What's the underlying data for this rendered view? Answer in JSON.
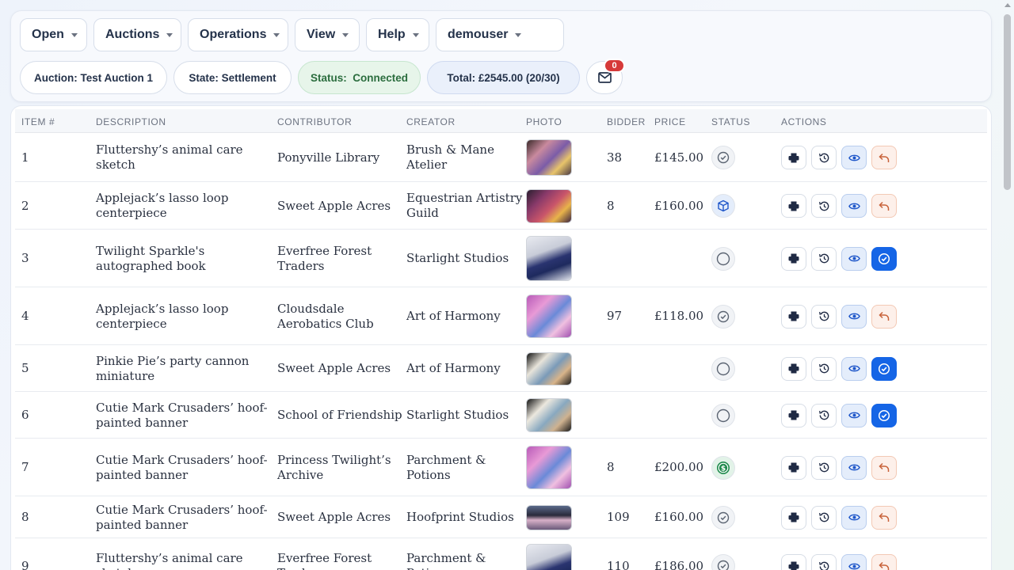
{
  "menu": {
    "open": "Open",
    "auctions": "Auctions",
    "operations": "Operations",
    "view": "View",
    "help": "Help",
    "user": "demouser"
  },
  "pills": {
    "auction": "Auction: Test Auction 1",
    "state": "State: Settlement",
    "status": "Status:  Connected",
    "total": "Total: £2545.00 (20/30)"
  },
  "mail": {
    "icon": "mail-icon",
    "badge": "0"
  },
  "table": {
    "headers": {
      "item": "ITEM #",
      "description": "DESCRIPTION",
      "contributor": "CONTRIBUTOR",
      "creator": "CREATOR",
      "photo": "PHOTO",
      "bidder": "BIDDER",
      "price": "PRICE",
      "status": "STATUS",
      "actions": "ACTIONS"
    },
    "rows": [
      {
        "item": "1",
        "desc1": "Fluttershy’s animal care",
        "desc2": "sketch",
        "contrib1": "Ponyville Library",
        "contrib2": "",
        "creator1": "Brush & Mane",
        "creator2": "Atelier",
        "bidder": "38",
        "price": "£145.00",
        "status": "check",
        "action": "undo"
      },
      {
        "item": "2",
        "desc1": "Applejack’s lasso loop",
        "desc2": "centerpiece",
        "contrib1": "Sweet Apple Acres",
        "contrib2": "",
        "creator1": "Equestrian Artistry",
        "creator2": "Guild",
        "bidder": "8",
        "price": "£160.00",
        "status": "box",
        "action": "undo"
      },
      {
        "item": "3",
        "desc1": "Twilight Sparkle's",
        "desc2": "autographed book",
        "contrib1": "Everfree Forest",
        "contrib2": "Traders",
        "creator1": "Starlight Studios",
        "creator2": "",
        "bidder": "",
        "price": "",
        "status": "empty",
        "action": "confirm"
      },
      {
        "item": "4",
        "desc1": "Applejack’s lasso loop",
        "desc2": "centerpiece",
        "contrib1": "Cloudsdale",
        "contrib2": "Aerobatics Club",
        "creator1": "Art of Harmony",
        "creator2": "",
        "bidder": "97",
        "price": "£118.00",
        "status": "check",
        "action": "undo"
      },
      {
        "item": "5",
        "desc1": "Pinkie Pie’s party cannon",
        "desc2": "miniature",
        "contrib1": "Sweet Apple Acres",
        "contrib2": "",
        "creator1": "Art of Harmony",
        "creator2": "",
        "bidder": "",
        "price": "",
        "status": "empty",
        "action": "confirm"
      },
      {
        "item": "6",
        "desc1": "Cutie Mark Crusaders’ hoof-",
        "desc2": "painted banner",
        "contrib1": "School of Friendship",
        "contrib2": "",
        "creator1": "Starlight Studios",
        "creator2": "",
        "bidder": "",
        "price": "",
        "status": "empty",
        "action": "confirm"
      },
      {
        "item": "7",
        "desc1": "Cutie Mark Crusaders’ hoof-",
        "desc2": "painted banner",
        "contrib1": "Princess Twilight’s",
        "contrib2": "Archive",
        "creator1": "Parchment &",
        "creator2": "Potions",
        "bidder": "8",
        "price": "£200.00",
        "status": "paid",
        "action": "undo"
      },
      {
        "item": "8",
        "desc1": "Cutie Mark Crusaders’ hoof-",
        "desc2": "painted banner",
        "contrib1": "Sweet Apple Acres",
        "contrib2": "",
        "creator1": "Hoofprint Studios",
        "creator2": "",
        "bidder": "109",
        "price": "£160.00",
        "status": "check",
        "action": "undo"
      },
      {
        "item": "9",
        "desc1": "Fluttershy’s animal care",
        "desc2": "sketch",
        "contrib1": "Everfree Forest",
        "contrib2": "Traders",
        "creator1": "Parchment &",
        "creator2": "Potions",
        "bidder": "110",
        "price": "£186.00",
        "status": "check",
        "action": "undo"
      }
    ]
  },
  "colors": {
    "accent": "#1565e6",
    "connected": "#2b6d3e",
    "badge": "#d63a3a",
    "paid": "#1f8a4c"
  }
}
